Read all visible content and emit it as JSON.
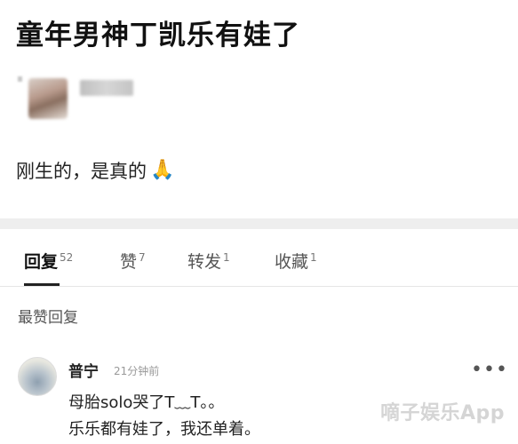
{
  "post": {
    "title": "童年男神丁凯乐有娃了",
    "content": "刚生的，是真的",
    "pray_icon": "🙏"
  },
  "tabs": [
    {
      "label": "回复",
      "count": "52",
      "active": true
    },
    {
      "label": "赞",
      "count": "7",
      "active": false
    },
    {
      "label": "转发",
      "count": "1",
      "active": false
    },
    {
      "label": "收藏",
      "count": "1",
      "active": false
    }
  ],
  "section_label": "最赞回复",
  "comment": {
    "author": "普宁",
    "time": "21分钟前",
    "more_icon": "•••",
    "line1": "母胎solo哭了T﹏T。。",
    "line2": "乐乐都有娃了，我还单着。"
  },
  "watermark": "嘀子娱乐App",
  "colors": {
    "accent": "#222222",
    "divider": "#eeeeee"
  }
}
